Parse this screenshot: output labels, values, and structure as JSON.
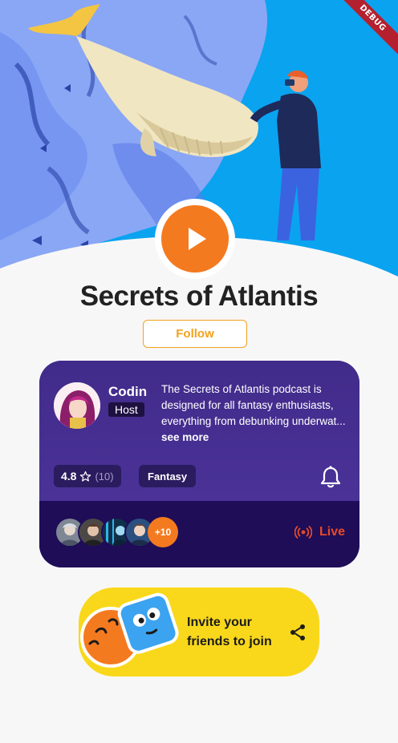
{
  "debug_banner": "DEBUG",
  "podcast": {
    "title": "Secrets of Atlantis",
    "follow_label": "Follow"
  },
  "host": {
    "name": "Codin",
    "role": "Host"
  },
  "description": {
    "text": "The Secrets of Atlantis podcast is designed for all fantasy enthusiasts, everything from debunking underwat...",
    "see_more": "see more"
  },
  "rating": {
    "value": "4.8",
    "count": "(10)"
  },
  "genre": "Fantasy",
  "listeners": {
    "more_count": "+10"
  },
  "live_label": "Live",
  "invite": {
    "line1": "Invite your",
    "line2": "friends to join"
  },
  "colors": {
    "accent_orange": "#f47a20",
    "follow_gold": "#f3a21d",
    "card_purple": "#452f91",
    "card_dark": "#1f0d57",
    "live_red": "#e84a2a",
    "invite_yellow": "#f9d81b"
  }
}
